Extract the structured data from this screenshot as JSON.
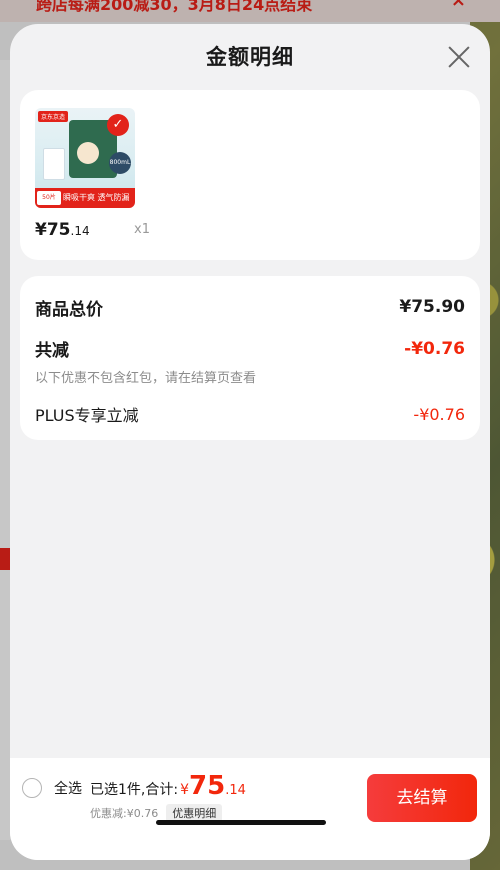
{
  "background": {
    "banner_text": "跨店每满200减30，3月8日24点结束",
    "banner_close": "×"
  },
  "sheet": {
    "title": "金额明细",
    "close_icon": "close-icon"
  },
  "product": {
    "thumb_logo": "京东京造",
    "thumb_bar_tag": "50片",
    "thumb_bar_text": "瞬吸干爽 透气防漏",
    "thumb_badge": "800mL",
    "price_symbol": "¥",
    "price_int": "75",
    "price_dec": ".14",
    "quantity": "x1"
  },
  "summary": {
    "total_label": "商品总价",
    "total_value": "¥75.90",
    "reduce_label": "共减",
    "reduce_value": "-¥0.76",
    "reduce_note": "以下优惠不包含红包，请在结算页查看",
    "plus_label": "PLUS专享立减",
    "plus_value": "-¥0.76"
  },
  "bottom": {
    "select_all": "全选",
    "selected_prefix": "已选1件,合计:",
    "total_symbol": "¥",
    "total_int": "75",
    "total_dec": ".14",
    "discount_text": "优惠减:¥0.76",
    "detail_tag": "优惠明细",
    "checkout": "去结算"
  },
  "colors": {
    "accent_red": "#f2270c",
    "text_dark": "#1a1a1a",
    "text_grey": "#8c8c8c"
  }
}
